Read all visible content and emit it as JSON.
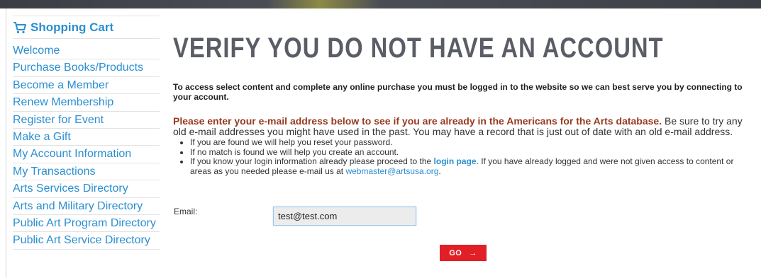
{
  "sidebar": {
    "cart_label": "Shopping Cart",
    "items": [
      {
        "label": "Welcome"
      },
      {
        "label": "Purchase Books/Products"
      },
      {
        "label": "Become a Member"
      },
      {
        "label": "Renew Membership"
      },
      {
        "label": "Register for Event"
      },
      {
        "label": "Make a Gift"
      },
      {
        "label": "My Account Information"
      },
      {
        "label": "My Transactions"
      },
      {
        "label": "Arts Services Directory"
      },
      {
        "label": "Arts and Military Directory"
      },
      {
        "label": "Public Art Program Directory"
      },
      {
        "label": "Public Art Service Directory"
      }
    ]
  },
  "main": {
    "title": "VERIFY YOU DO NOT HAVE AN ACCOUNT",
    "intro": "To access select content and complete any online purchase you must be logged in to the website so we can best serve you by connecting to your account.",
    "lead_emph": "Please enter your e-mail address below to see if you are already in the Americans for the Arts database.",
    "lead_rest": " Be sure to try any old e-mail addresses you might have used in the past. You may have a record that is just out of date with an old e-mail address.",
    "bullets": {
      "b1": "If you are found we will help you reset your password.",
      "b2": "If no match is found we will help you create an account.",
      "b3_pre": "If you know your login information already please proceed to the ",
      "b3_link": "login page",
      "b3_mid": ". If you have already logged and were not given access to content or areas as you needed please e-mail us at ",
      "b3_mail": "webmaster@artsusa.org",
      "b3_end": "."
    },
    "email_label": "Email:",
    "email_value": "test@test.com",
    "go_label": "GO",
    "go_arrow": "→"
  },
  "colors": {
    "link": "#2b8fd0",
    "emphasis": "#963a1f",
    "button": "#e11f26",
    "title": "#5a5d66"
  },
  "icons": {
    "cart": "shopping-cart-icon"
  }
}
